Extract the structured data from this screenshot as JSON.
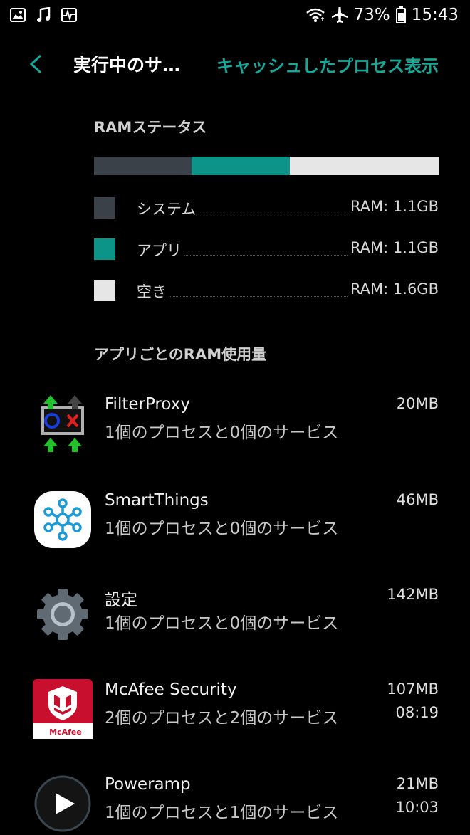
{
  "status_bar": {
    "battery": "73%",
    "time": "15:43"
  },
  "header": {
    "title": "実行中のサ…",
    "show_cached_label": "キャッシュしたプロセス表示"
  },
  "ram_status": {
    "label": "RAMステータス",
    "bar_fractions": {
      "system": 0.284,
      "apps": 0.284,
      "free": 0.432
    },
    "colors": {
      "system": "#3a4148",
      "apps": "#0d9488",
      "free": "#e6e6e6"
    },
    "legend": [
      {
        "label": "システム",
        "value": "RAM: 1.1GB"
      },
      {
        "label": "アプリ",
        "value": "RAM: 1.1GB"
      },
      {
        "label": "空き",
        "value": "RAM: 1.6GB"
      }
    ]
  },
  "per_app_label": "アプリごとのRAM使用量",
  "apps": [
    {
      "icon": "filterproxy-icon",
      "name": "FilterProxy",
      "desc": "1個のプロセスと0個のサービス",
      "size": "20MB",
      "time": ""
    },
    {
      "icon": "smartthings-icon",
      "name": "SmartThings",
      "desc": "1個のプロセスと0個のサービス",
      "size": "46MB",
      "time": ""
    },
    {
      "icon": "settings-gear-icon",
      "name": "設定",
      "desc": "1個のプロセスと0個のサービス",
      "size": "142MB",
      "time": ""
    },
    {
      "icon": "mcafee-icon",
      "name": "McAfee Security",
      "desc": "2個のプロセスと2個のサービス",
      "size": "107MB",
      "time": "08:19",
      "brand": "McAfee"
    },
    {
      "icon": "poweramp-icon",
      "name": "Poweramp",
      "desc": "1個のプロセスと1個のサービス",
      "size": "21MB",
      "time": "10:03"
    }
  ]
}
